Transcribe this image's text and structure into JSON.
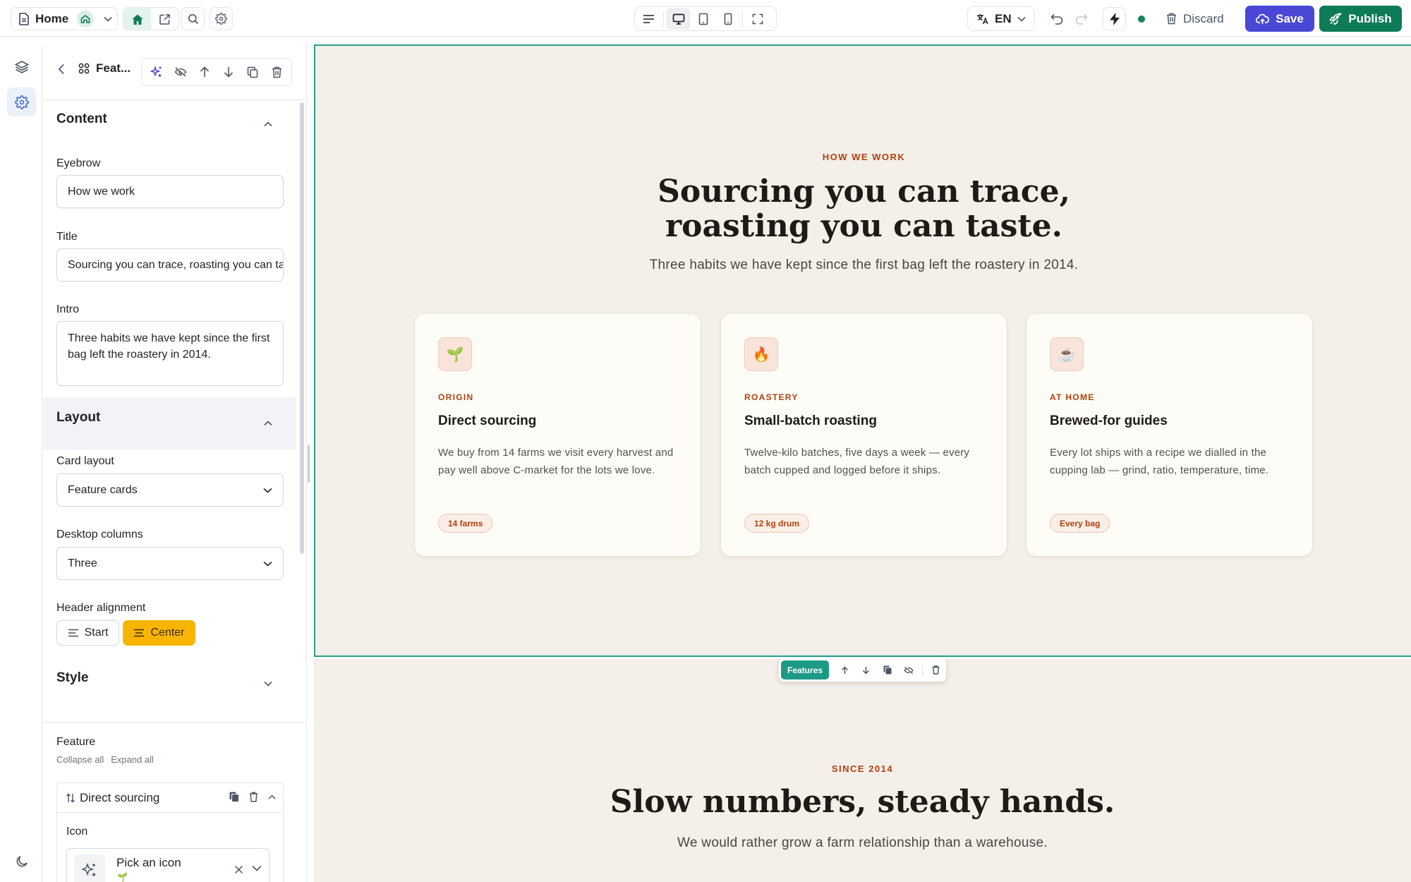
{
  "topbar": {
    "page_name": "Home",
    "language": "EN",
    "discard_label": "Discard",
    "save_label": "Save",
    "publish_label": "Publish",
    "status": "saved",
    "viewport_active": "desktop"
  },
  "panel": {
    "block_title": "Feat...",
    "content": {
      "heading": "Content",
      "eyebrow_label": "Eyebrow",
      "eyebrow_value": "How we work",
      "title_label": "Title",
      "title_value": "Sourcing you can trace, roasting you can taste.",
      "intro_label": "Intro",
      "intro_value": "Three habits we have kept since the first bag left the roastery in 2014."
    },
    "layout": {
      "heading": "Layout",
      "card_layout_label": "Card layout",
      "card_layout_value": "Feature cards",
      "columns_label": "Desktop columns",
      "columns_value": "Three",
      "alignment_label": "Header alignment",
      "align_start": "Start",
      "align_center": "Center",
      "align_selected": "Center"
    },
    "style": {
      "heading": "Style"
    },
    "feature": {
      "label": "Feature",
      "collapse_all": "Collapse all",
      "expand_all": "Expand all",
      "item_title": "Direct sourcing",
      "icon_label": "Icon",
      "icon_picker_title": "Pick an icon",
      "icon_picker_value": "🌱"
    }
  },
  "section1": {
    "eyebrow": "How we work",
    "title_line1": "Sourcing you can trace,",
    "title_line2": "roasting you can taste.",
    "intro": "Three habits we have kept since the first bag left the roastery in 2014.",
    "cards": [
      {
        "icon": "🌱",
        "eyebrow": "ORIGIN",
        "title": "Direct sourcing",
        "body": "We buy from 14 farms we visit every harvest and pay well above C-market for the lots we love.",
        "badge": "14 farms"
      },
      {
        "icon": "🔥",
        "eyebrow": "ROASTERY",
        "title": "Small-batch roasting",
        "body": "Twelve-kilo batches, five days a week — every batch cupped and logged before it ships.",
        "badge": "12 kg drum"
      },
      {
        "icon": "☕",
        "eyebrow": "AT HOME",
        "title": "Brewed-for guides",
        "body": "Every lot ships with a recipe we dialled in the cupping lab — grind, ratio, temperature, time.",
        "badge": "Every bag"
      }
    ]
  },
  "floatbar": {
    "tag": "Features"
  },
  "section2": {
    "eyebrow": "Since 2014",
    "title": "Slow numbers, steady hands.",
    "intro": "We would rather grow a farm relationship than a warehouse."
  },
  "colors": {
    "save": "#4a47d6",
    "publish": "#0d7a58",
    "accent": "#b2400f",
    "selection": "#2aa08a",
    "align_selected": "#f7b500",
    "canvas_bg": "#f4efe8"
  }
}
